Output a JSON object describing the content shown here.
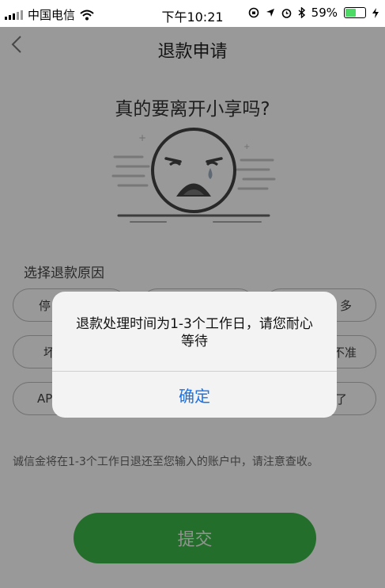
{
  "status_bar": {
    "carrier": "中国电信",
    "time": "下午10:21",
    "battery_percent": "59%",
    "battery_level": 0.59,
    "icons": [
      "signal-icon",
      "wifi-icon",
      "lock-rotation-icon",
      "location-icon",
      "alarm-icon",
      "bluetooth-icon",
      "battery-icon",
      "charging-icon"
    ]
  },
  "nav": {
    "back_icon": "chevron-left-icon",
    "title": "退款申请"
  },
  "headline": "真的要离开小享吗?",
  "reasons": {
    "label": "选择退款原因",
    "items": [
      "停",
      "多",
      "坏",
      "不准",
      "AP",
      "了"
    ]
  },
  "notice": "诚信金将在1-3个工作日退还至您输入的账户中，请注意查收。",
  "submit_label": "提交",
  "dialog": {
    "message_line1": "退款处理时间为1-3个工作日，请您耐心",
    "message_line2": "等待",
    "confirm_label": "确定"
  },
  "colors": {
    "primary_green": "#3cb84a",
    "link_blue": "#1a73e8",
    "battery_green": "#4cd964"
  }
}
